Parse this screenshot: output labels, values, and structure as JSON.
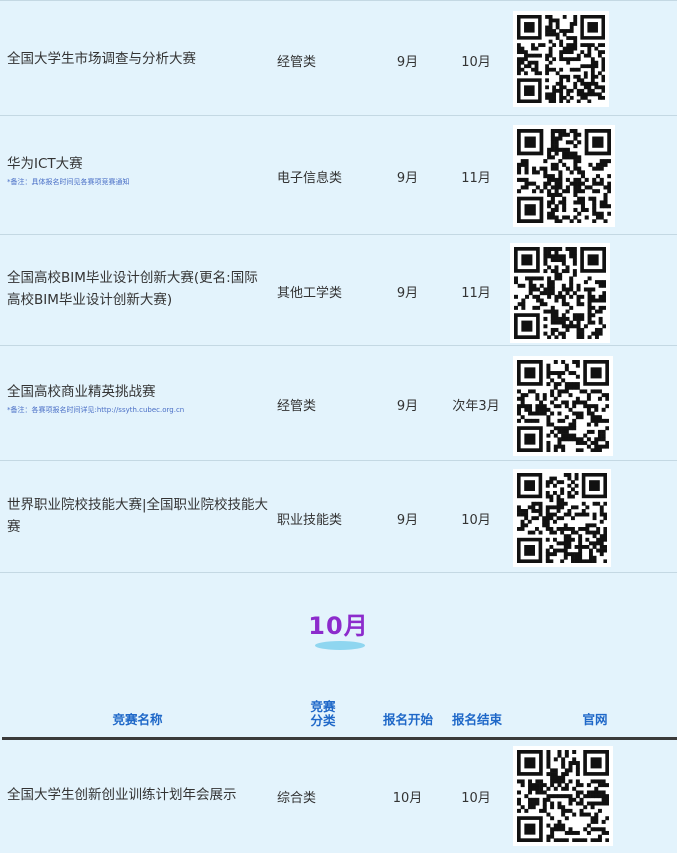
{
  "rows_top": [
    {
      "name": "全国大学生市场调查与分析大赛",
      "note": "",
      "type": "经管类",
      "start": "9月",
      "end": "10月"
    },
    {
      "name": "华为ICT大赛",
      "note": "*备注：具体报名时间见各赛项竞赛通知",
      "type": "电子信息类",
      "start": "9月",
      "end": "11月"
    },
    {
      "name": "全国高校BIM毕业设计创新大赛(更名:国际高校BIM毕业设计创新大赛)",
      "note": "",
      "type": "其他工学类",
      "start": "9月",
      "end": "11月"
    },
    {
      "name": "全国高校商业精英挑战赛",
      "note": "*备注：各赛项报名时间详见:http://ssyth.cubec.org.cn",
      "type": "经管类",
      "start": "9月",
      "end": "次年3月"
    },
    {
      "name": "世界职业院校技能大赛|全国职业院校技能大赛",
      "note": "",
      "type": "职业技能类",
      "start": "9月",
      "end": "10月"
    }
  ],
  "section": {
    "month": "10月"
  },
  "header": {
    "name": "竞赛名称",
    "type_line1": "竞赛",
    "type_line2": "分类",
    "start": "报名开始",
    "end": "报名结束",
    "site": "官网"
  },
  "rows_bottom": [
    {
      "name": "全国大学生创新创业训练计划年会展示",
      "note": "",
      "type": "综合类",
      "start": "10月",
      "end": "10月"
    }
  ]
}
